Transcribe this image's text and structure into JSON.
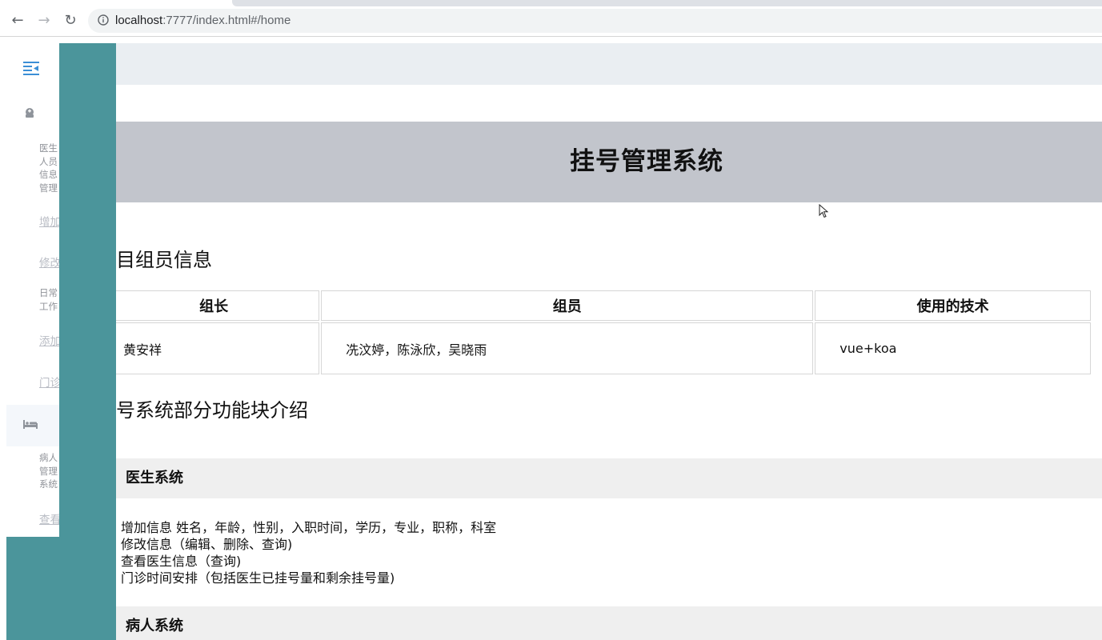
{
  "browser": {
    "url_host": "localhost",
    "url_rest": ":7777/index.html#/home"
  },
  "sidebar": {
    "groups": [
      {
        "label": "医生\n人员\n信息\n管理",
        "icon": "doctor-icon"
      },
      {
        "label": "日常\n工作",
        "icon": ""
      },
      {
        "label": "病人\n管理\n系统",
        "icon": "bed-icon"
      }
    ],
    "links": [
      "增加",
      "修改",
      "添加",
      "门诊",
      "查看"
    ]
  },
  "main": {
    "banner_title": "挂号管理系统",
    "team_section_title": "目组员信息",
    "team_table": {
      "headers": [
        "组长",
        "组员",
        "使用的技术"
      ],
      "row": [
        "黄安祥",
        "冼汶婷，陈泳欣，吴晓雨",
        "vue+koa"
      ]
    },
    "features_section_title": "号系统部分功能块介绍",
    "doctor_system": {
      "title": "医生系统",
      "items": [
        "增加信息 姓名，年龄，性别，入职时间，学历，专业，职称，科室",
        "修改信息（编辑、删除、查询)",
        "查看医生信息（查询)",
        "门诊时间安排（包括医生已挂号量和剩余挂号量)"
      ]
    },
    "patient_system": {
      "title": "病人系统"
    }
  },
  "colors": {
    "teal": "#4b959b",
    "banner": "#c2c5cc",
    "topband": "#eaeef2",
    "menu_icon": "#3b8fd6"
  }
}
